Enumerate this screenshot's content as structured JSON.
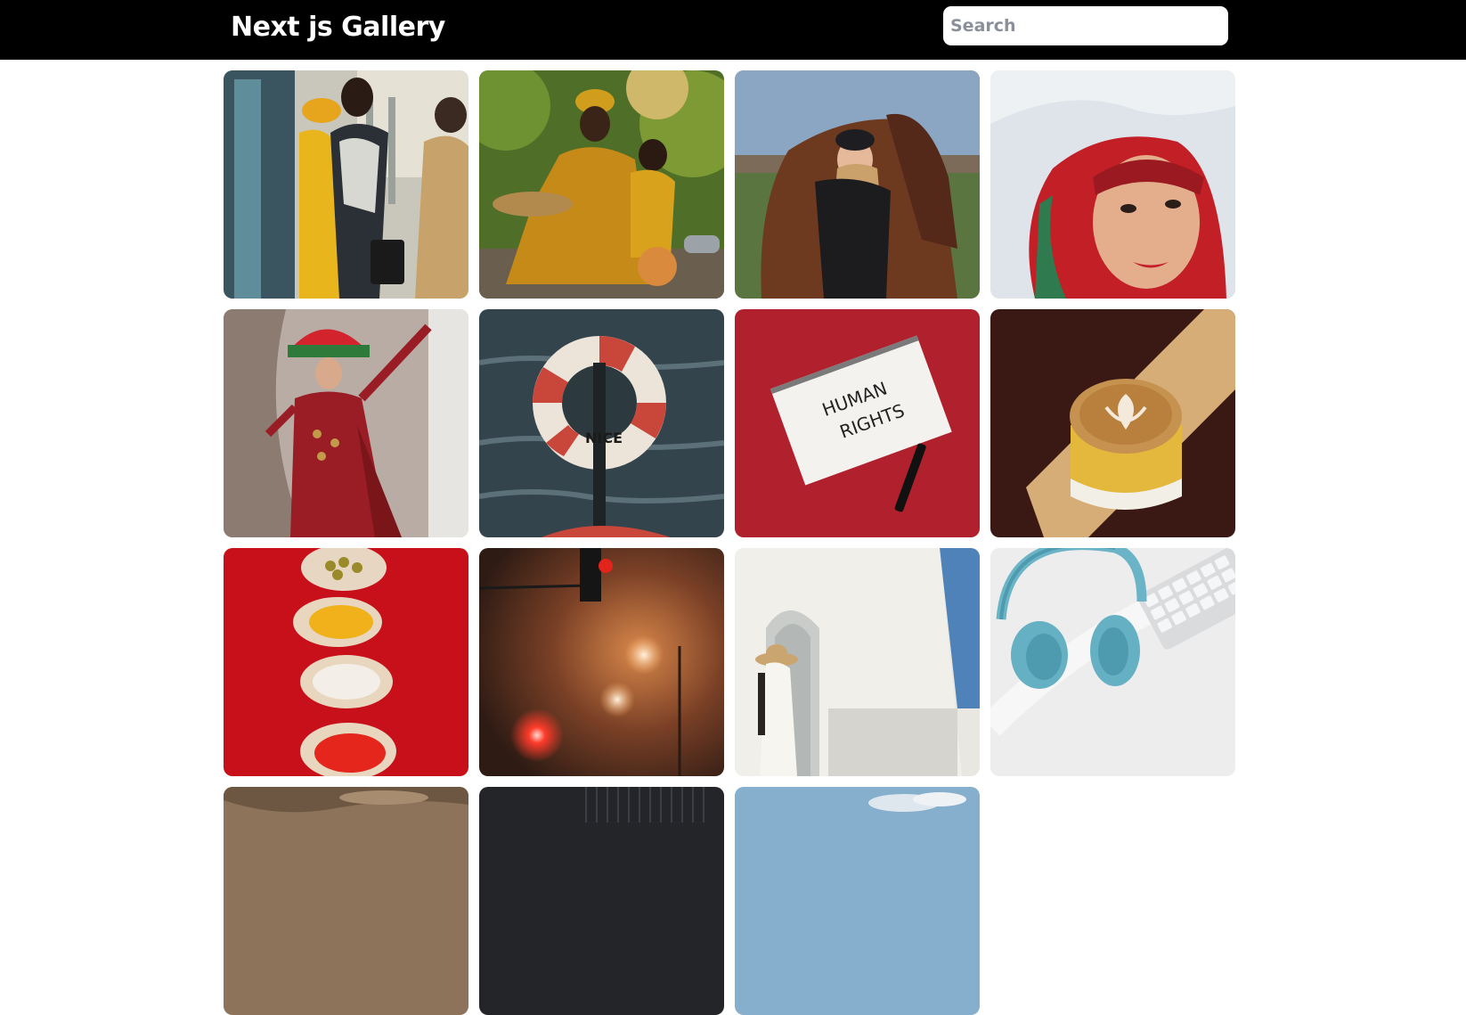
{
  "header": {
    "title": "Next js Gallery"
  },
  "search": {
    "placeholder": "Search",
    "value": "",
    "icon": "none"
  },
  "gallery": {
    "images": [
      {
        "subject": "women-traditional-dress-window",
        "colors": [
          "#2d4450",
          "#d9a326",
          "#e9e0cf"
        ]
      },
      {
        "subject": "mother-child-yellow-dress",
        "colors": [
          "#6b8f32",
          "#c28a18",
          "#3c3a14"
        ]
      },
      {
        "subject": "woman-with-horse",
        "colors": [
          "#8aa6c0",
          "#6f3a1c",
          "#4f6a2c"
        ]
      },
      {
        "subject": "woman-red-headscarf",
        "colors": [
          "#d8dde5",
          "#c0242a",
          "#e0a988"
        ]
      },
      {
        "subject": "woman-red-costume-hat",
        "colors": [
          "#b3aaa5",
          "#8f1e24",
          "#2b7a3a"
        ]
      },
      {
        "subject": "life-buoy-le-roi-des-iles-nice",
        "colors": [
          "#2d3a42",
          "#c64a35",
          "#efe7dc"
        ]
      },
      {
        "subject": "human-rights-notebook",
        "colors": [
          "#b22330",
          "#f3f1ee",
          "#1a1a1a"
        ]
      },
      {
        "subject": "latte-coffee-cup",
        "colors": [
          "#3b1a15",
          "#d9a96a",
          "#e5b93a"
        ]
      },
      {
        "subject": "spices-in-bowls",
        "colors": [
          "#c9111a",
          "#eadbc8",
          "#f2b51d"
        ]
      },
      {
        "subject": "traffic-light-fog",
        "colors": [
          "#3a2217",
          "#e57a3b",
          "#ff4030"
        ]
      },
      {
        "subject": "woman-white-arch",
        "colors": [
          "#d9dcd8",
          "#f2f0ea",
          "#3d6fa6"
        ]
      },
      {
        "subject": "blue-headphones-keyboard",
        "colors": [
          "#ecebec",
          "#6cb6c8",
          "#d5d7d9"
        ]
      },
      {
        "subject": "cropped-landscape-1",
        "colors": [
          "#8d7359"
        ]
      },
      {
        "subject": "cropped-architecture-2",
        "colors": [
          "#2a2c30"
        ]
      },
      {
        "subject": "cropped-sky-3",
        "colors": [
          "#8db2cf"
        ]
      }
    ]
  }
}
